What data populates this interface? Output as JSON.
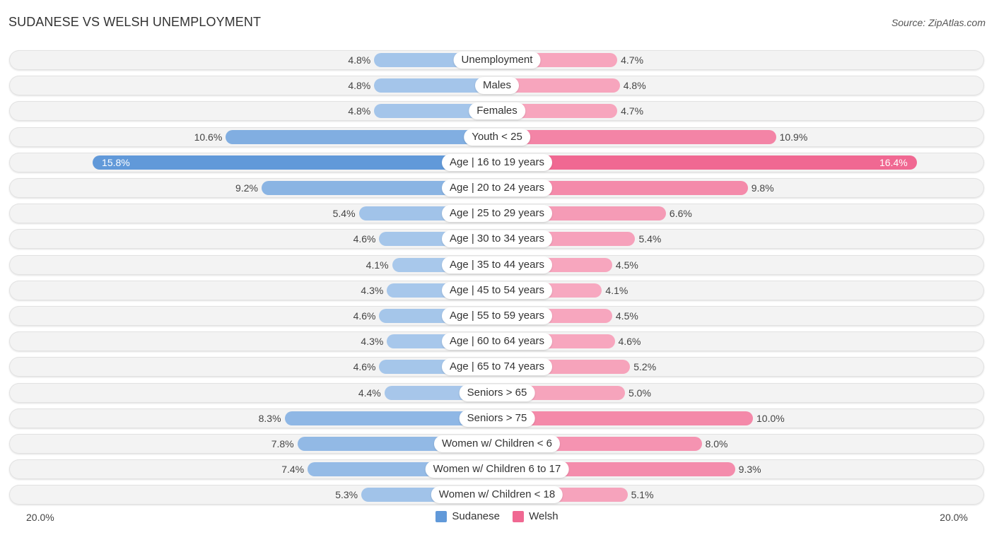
{
  "header": {
    "title": "SUDANESE VS WELSH UNEMPLOYMENT",
    "source": "Source: ZipAtlas.com"
  },
  "colors": {
    "sudanese_strong": "#6199d9",
    "sudanese_light": "#a9c8eb",
    "welsh_strong": "#f06892",
    "welsh_light": "#f7a9c0"
  },
  "chart_data": {
    "type": "bar",
    "orientation": "horizontal-diverging",
    "title": "SUDANESE VS WELSH UNEMPLOYMENT",
    "categories": [
      "Unemployment",
      "Males",
      "Females",
      "Youth < 25",
      "Age | 16 to 19 years",
      "Age | 20 to 24 years",
      "Age | 25 to 29 years",
      "Age | 30 to 34 years",
      "Age | 35 to 44 years",
      "Age | 45 to 54 years",
      "Age | 55 to 59 years",
      "Age | 60 to 64 years",
      "Age | 65 to 74 years",
      "Seniors > 65",
      "Seniors > 75",
      "Women w/ Children < 6",
      "Women w/ Children 6 to 17",
      "Women w/ Children < 18"
    ],
    "series": [
      {
        "name": "Sudanese",
        "side": "left",
        "values": [
          4.8,
          4.8,
          4.8,
          10.6,
          15.8,
          9.2,
          5.4,
          4.6,
          4.1,
          4.3,
          4.6,
          4.3,
          4.6,
          4.4,
          8.3,
          7.8,
          7.4,
          5.3
        ],
        "labels": [
          "4.8%",
          "4.8%",
          "4.8%",
          "10.6%",
          "15.8%",
          "9.2%",
          "5.4%",
          "4.6%",
          "4.1%",
          "4.3%",
          "4.6%",
          "4.3%",
          "4.6%",
          "4.4%",
          "8.3%",
          "7.8%",
          "7.4%",
          "5.3%"
        ]
      },
      {
        "name": "Welsh",
        "side": "right",
        "values": [
          4.7,
          4.8,
          4.7,
          10.9,
          16.4,
          9.8,
          6.6,
          5.4,
          4.5,
          4.1,
          4.5,
          4.6,
          5.2,
          5.0,
          10.0,
          8.0,
          9.3,
          5.1
        ],
        "labels": [
          "4.7%",
          "4.8%",
          "4.7%",
          "10.9%",
          "16.4%",
          "9.8%",
          "6.6%",
          "5.4%",
          "4.5%",
          "4.1%",
          "4.5%",
          "4.6%",
          "5.2%",
          "5.0%",
          "10.0%",
          "8.0%",
          "9.3%",
          "5.1%"
        ]
      }
    ],
    "xlim": [
      -20,
      20
    ],
    "axis_labels": {
      "left": "20.0%",
      "right": "20.0%"
    },
    "unit": "%",
    "legend": {
      "position": "bottom-center",
      "entries": [
        "Sudanese",
        "Welsh"
      ]
    },
    "grid": false
  }
}
